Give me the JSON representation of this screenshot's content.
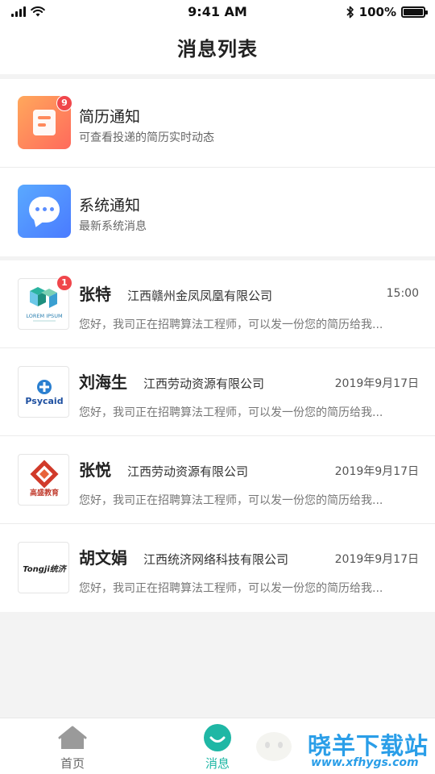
{
  "status_bar": {
    "time": "9:41 AM",
    "battery": "100%"
  },
  "header": {
    "title": "消息列表"
  },
  "notices": [
    {
      "title": "简历通知",
      "subtitle": "可查看投递的简历实时动态",
      "badge": "9",
      "icon": "resume-icon",
      "color": "#ff7a5c"
    },
    {
      "title": "系统通知",
      "subtitle": "最新系统消息",
      "icon": "chat-bubble-icon",
      "color": "#4a8bff"
    }
  ],
  "chats": [
    {
      "name": "张特",
      "company": "江西赣州金凤凤凰有限公司",
      "time": "15:00",
      "message": "您好，我司正在招聘算法工程师，可以发一份您的简历给我...",
      "badge": "1",
      "logo_text": "LOREM IPSUM"
    },
    {
      "name": "刘海生",
      "company": "江西劳动资源有限公司",
      "time": "2019年9月17日",
      "message": "您好，我司正在招聘算法工程师，可以发一份您的简历给我...",
      "logo_text": "Psycaid"
    },
    {
      "name": "张悦",
      "company": "江西劳动资源有限公司",
      "time": "2019年9月17日",
      "message": "您好，我司正在招聘算法工程师，可以发一份您的简历给我...",
      "logo_text": "高盛教育"
    },
    {
      "name": "胡文娟",
      "company": "江西统济网络科技有限公司",
      "time": "2019年9月17日",
      "message": "您好，我司正在招聘算法工程师，可以发一份您的简历给我...",
      "logo_text": "Tongji统济"
    }
  ],
  "tabbar": {
    "items": [
      {
        "label": "首页",
        "icon": "home-icon"
      },
      {
        "label": "消息",
        "icon": "message-icon",
        "active": true
      }
    ]
  },
  "watermark": {
    "main": "晓羊下载站",
    "sub": "www.xfhygs.com"
  },
  "colors": {
    "accent": "#1fb7a5",
    "badge": "#f0464b"
  }
}
